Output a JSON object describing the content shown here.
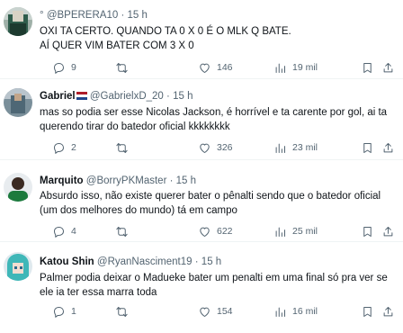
{
  "tweets": [
    {
      "name": "",
      "badge": "°",
      "handle": "@BPERERA10",
      "dot": "·",
      "time": "15 h",
      "lines": [
        "OXI TA CERTO. QUANDO TA 0 X 0 É O MLK Q BATE.",
        "AÍ QUER VIM BATER COM 3 X 0"
      ],
      "replies": "9",
      "retweets": "",
      "likes": "146",
      "views": "19 mil"
    },
    {
      "name": "Gabriel",
      "flag": "netherlands-flag",
      "handle": "@GabrielxD_20",
      "dot": "·",
      "time": "15 h",
      "lines": [
        "mas so podia ser esse Nicolas Jackson, é horrível e ta carente por gol, ai ta",
        "querendo tirar do batedor oficial kkkkkkkk"
      ],
      "replies": "2",
      "retweets": "",
      "likes": "326",
      "views": "23 mil"
    },
    {
      "name": "Marquito",
      "handle": "@BorryPKMaster",
      "dot": "·",
      "time": "15 h",
      "lines": [
        "Absurdo isso, não existe querer bater o pênalti sendo que o batedor oficial",
        "(um dos melhores do mundo) tá em campo"
      ],
      "replies": "4",
      "retweets": "",
      "likes": "622",
      "views": "25 mil"
    },
    {
      "name": "Katou Shin",
      "handle": "@RyanNasciment19",
      "dot": "·",
      "time": "15 h",
      "lines": [
        "Palmer podia deixar o Madueke bater um penalti em uma final só pra ver se",
        "ele ia ter essa marra toda"
      ],
      "replies": "1",
      "retweets": "",
      "likes": "154",
      "views": "16 mil"
    }
  ],
  "colors": {
    "text": "#0f1419",
    "secondary": "#536471",
    "divider": "#eff3f4"
  },
  "icons": [
    "reply-icon",
    "retweet-icon",
    "like-icon",
    "views-icon",
    "bookmark-icon",
    "share-icon"
  ]
}
